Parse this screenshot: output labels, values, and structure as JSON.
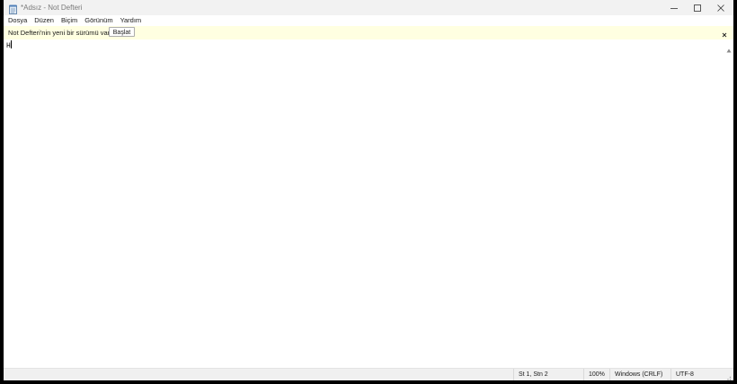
{
  "window": {
    "title": "*Adsız - Not Defteri",
    "controls": {
      "minimize": "minimize-icon",
      "maximize": "maximize-icon",
      "close": "close-icon"
    }
  },
  "menu": {
    "items": [
      {
        "label": "Dosya"
      },
      {
        "label": "Düzen"
      },
      {
        "label": "Biçim"
      },
      {
        "label": "Görünüm"
      },
      {
        "label": "Yardım"
      }
    ]
  },
  "infobar": {
    "message": "Not Defteri'nin yeni bir sürümü var.",
    "button_label": "Başlat",
    "background": "#ffffe1"
  },
  "editor": {
    "content": "H"
  },
  "status": {
    "position": "St 1, Stn 2",
    "zoom": "100%",
    "line_endings": "Windows (CRLF)",
    "encoding": "UTF-8"
  }
}
